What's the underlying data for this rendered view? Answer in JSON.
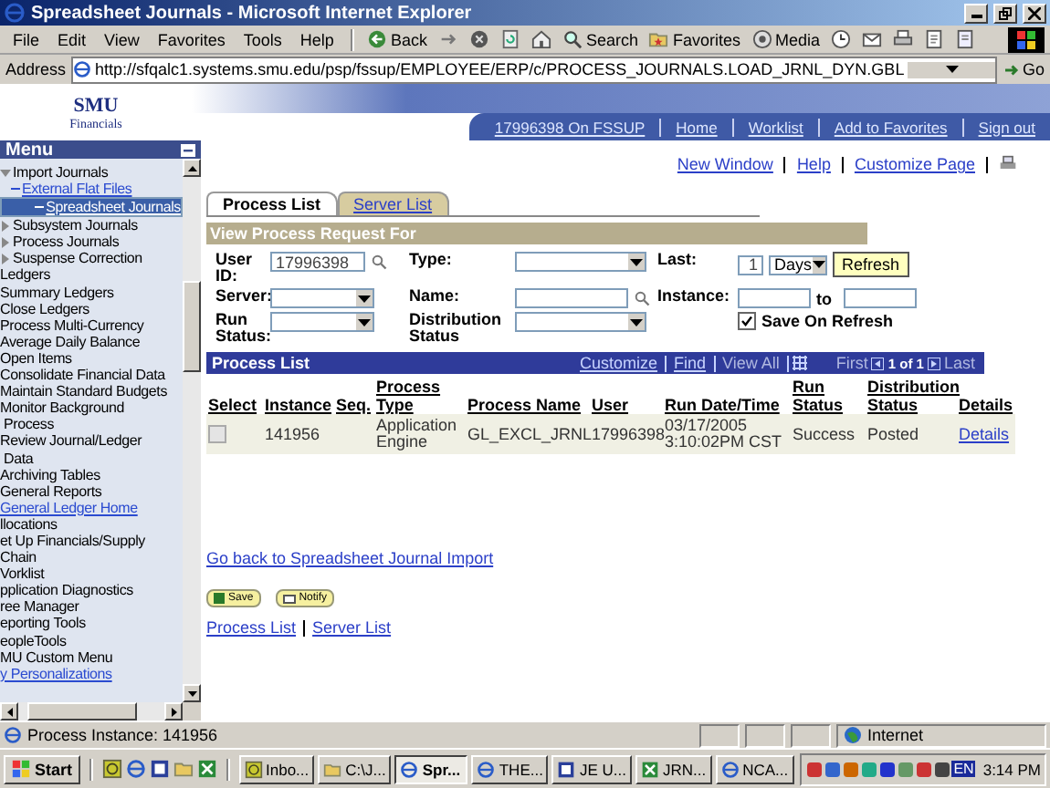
{
  "window": {
    "title": "Spreadsheet Journals - Microsoft Internet Explorer"
  },
  "menu_bar": [
    "File",
    "Edit",
    "View",
    "Favorites",
    "Tools",
    "Help"
  ],
  "toolbar": [
    {
      "kind": "back",
      "label": "Back"
    },
    {
      "kind": "forward"
    },
    {
      "kind": "stop"
    },
    {
      "kind": "refresh"
    },
    {
      "kind": "home"
    },
    {
      "kind": "search",
      "label": "Search"
    },
    {
      "kind": "favorites",
      "label": "Favorites"
    },
    {
      "kind": "media",
      "label": "Media"
    },
    {
      "kind": "history"
    },
    {
      "kind": "mail"
    },
    {
      "kind": "print"
    },
    {
      "kind": "edit"
    },
    {
      "kind": "discuss"
    }
  ],
  "address_bar": {
    "label": "Address",
    "url": "http://sfqalc1.systems.smu.edu/psp/fssup/EMPLOYEE/ERP/c/PROCESS_JOURNALS.LOAD_JRNL_DYN.GBL",
    "go": "Go"
  },
  "header": {
    "logo": "SMU",
    "logo_sub": "Financials",
    "nav": [
      "17996398 On FSSUP",
      "Home",
      "Worklist",
      "Add to Favorites",
      "Sign out"
    ]
  },
  "menu": {
    "title": "Menu",
    "items": [
      {
        "kind": "tree",
        "label": "Import Journals",
        "expanded": true,
        "children": [
          {
            "label": "External Flat Files",
            "selected": false
          },
          {
            "label": "Spreadsheet Journals",
            "selected": true
          }
        ]
      },
      {
        "kind": "tree",
        "label": "Subsystem Journals",
        "expanded": false
      },
      {
        "kind": "tree",
        "label": "Process Journals",
        "expanded": false
      },
      {
        "kind": "tree",
        "label": "Suspense Correction",
        "expanded": false
      },
      {
        "kind": "plain",
        "label": "Ledgers"
      },
      {
        "kind": "plain",
        "label": "Summary Ledgers"
      },
      {
        "kind": "plain",
        "label": "Close Ledgers"
      },
      {
        "kind": "plain",
        "label": "Process Multi-Currency"
      },
      {
        "kind": "plain",
        "label": "Average Daily Balance"
      },
      {
        "kind": "plain",
        "label": "Open Items"
      },
      {
        "kind": "plain",
        "label": "Consolidate Financial Data"
      },
      {
        "kind": "plain",
        "label": "Maintain Standard Budgets"
      },
      {
        "kind": "plain",
        "label": "Monitor Background\n Process"
      },
      {
        "kind": "plain",
        "label": "Review Journal/Ledger\n Data"
      },
      {
        "kind": "plain",
        "label": "Archiving Tables"
      },
      {
        "kind": "plain",
        "label": "General Reports"
      },
      {
        "kind": "link",
        "label": "General Ledger Home"
      },
      {
        "kind": "plain",
        "label": "llocations"
      },
      {
        "kind": "plain",
        "label": "et Up Financials/Supply\nChain"
      },
      {
        "kind": "plain",
        "label": "Vorklist"
      },
      {
        "kind": "plain",
        "label": "pplication Diagnostics"
      },
      {
        "kind": "plain",
        "label": "ree Manager"
      },
      {
        "kind": "plain",
        "label": "eporting Tools"
      },
      {
        "kind": "plain",
        "label": "eopleTools"
      },
      {
        "kind": "plain",
        "label": "MU Custom Menu"
      },
      {
        "kind": "link",
        "label": "y Personalizations"
      }
    ]
  },
  "page_links": [
    "New Window",
    "Help",
    "Customize Page"
  ],
  "tabs": [
    {
      "label": "Process List",
      "selected": true
    },
    {
      "label": "Server List",
      "selected": false
    }
  ],
  "request_panel": {
    "title": "View Process Request For",
    "user_id_label": "User ID:",
    "user_id": "17996398",
    "type_label": "Type:",
    "last_label": "Last:",
    "last_value": "1",
    "last_unit": "Days",
    "refresh": "Refresh",
    "server_label": "Server:",
    "name_label": "Name:",
    "instance_label": "Instance:",
    "to_label": "to",
    "run_status_label": "Run Status:",
    "distribution_status_label": "Distribution Status",
    "save_on_refresh": {
      "label": "Save On Refresh",
      "checked": true
    }
  },
  "process_list": {
    "title": "Process List",
    "tools": [
      "Customize",
      "Find",
      "View All"
    ],
    "first": "First",
    "page": "1 of 1",
    "last": "Last",
    "columns": [
      "Select",
      "Instance",
      "Seq.",
      "Process Type",
      "Process Name",
      "User",
      "Run Date/Time",
      "Run Status",
      "Distribution Status",
      "Details"
    ],
    "rows": [
      {
        "checked": false,
        "instance": "141956",
        "process_type": "Application Engine",
        "process_name": "GL_EXCL_JRNL",
        "user": "17996398",
        "run_date_time": "03/17/2005\n3:10:02PM CST",
        "run_status": "Success",
        "distribution_status": "Posted",
        "details": "Details"
      }
    ]
  },
  "back_link": "Go back to Spreadsheet Journal Import",
  "buttons": [
    "Save",
    "Notify"
  ],
  "footer_links": [
    "Process List",
    "Server List"
  ],
  "status_bar": {
    "text": "Process Instance: 141956",
    "zone": "Internet"
  },
  "taskbar": {
    "start": "Start",
    "tasks": [
      {
        "kind": "mail",
        "label": "Inbo...",
        "selected": false
      },
      {
        "kind": "folder",
        "label": "C:\\J...",
        "selected": false
      },
      {
        "kind": "browser",
        "label": "Spr...",
        "selected": true
      },
      {
        "kind": "browser",
        "label": "THE...",
        "selected": false
      },
      {
        "kind": "word",
        "label": "JE U...",
        "selected": false
      },
      {
        "kind": "excel",
        "label": "JRN...",
        "selected": false
      },
      {
        "kind": "browser",
        "label": "NCA...",
        "selected": false
      }
    ],
    "language": "EN",
    "clock": "3:14 PM"
  }
}
